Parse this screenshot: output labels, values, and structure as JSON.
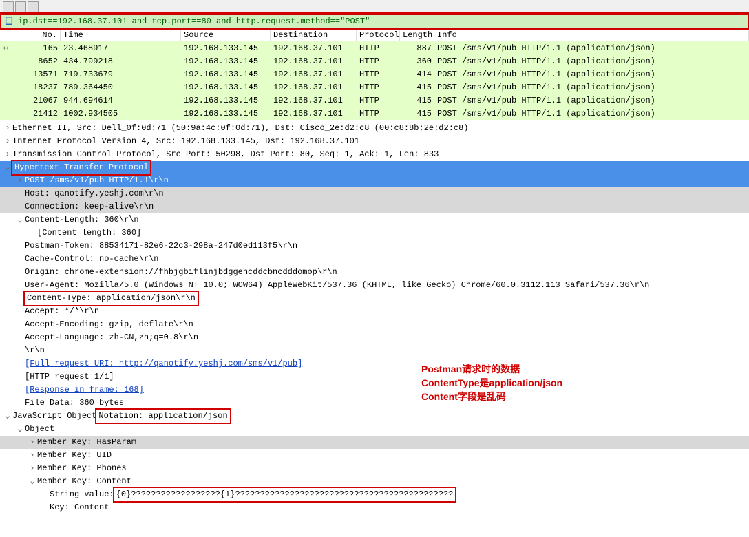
{
  "filter": {
    "value": "ip.dst==192.168.37.101 and tcp.port==80 and http.request.method==\"POST\""
  },
  "columns": {
    "no": "No.",
    "time": "Time",
    "src": "Source",
    "dst": "Destination",
    "proto": "Protocol",
    "len": "Length",
    "info": "Info"
  },
  "packets": [
    {
      "no": "165",
      "time": "23.468917",
      "src": "192.168.133.145",
      "dst": "192.168.37.101",
      "proto": "HTTP",
      "len": "887",
      "info": "POST /sms/v1/pub HTTP/1.1  (application/json)",
      "arrow": true
    },
    {
      "no": "8652",
      "time": "434.799218",
      "src": "192.168.133.145",
      "dst": "192.168.37.101",
      "proto": "HTTP",
      "len": "360",
      "info": "POST /sms/v1/pub HTTP/1.1  (application/json)"
    },
    {
      "no": "13571",
      "time": "719.733679",
      "src": "192.168.133.145",
      "dst": "192.168.37.101",
      "proto": "HTTP",
      "len": "414",
      "info": "POST /sms/v1/pub HTTP/1.1  (application/json)"
    },
    {
      "no": "18237",
      "time": "789.364450",
      "src": "192.168.133.145",
      "dst": "192.168.37.101",
      "proto": "HTTP",
      "len": "415",
      "info": "POST /sms/v1/pub HTTP/1.1  (application/json)"
    },
    {
      "no": "21067",
      "time": "944.694614",
      "src": "192.168.133.145",
      "dst": "192.168.37.101",
      "proto": "HTTP",
      "len": "415",
      "info": "POST /sms/v1/pub HTTP/1.1  (application/json)"
    },
    {
      "no": "21412",
      "time": "1002.934505",
      "src": "192.168.133.145",
      "dst": "192.168.37.101",
      "proto": "HTTP",
      "len": "415",
      "info": "POST /sms/v1/pub HTTP/1.1  (application/json)"
    }
  ],
  "tree": {
    "eth": "Ethernet II, Src: Dell_0f:0d:71 (50:9a:4c:0f:0d:71), Dst: Cisco_2e:d2:c8 (00:c8:8b:2e:d2:c8)",
    "ip": "Internet Protocol Version 4, Src: 192.168.133.145, Dst: 192.168.37.101",
    "tcp": "Transmission Control Protocol, Src Port: 50298, Dst Port: 80, Seq: 1, Ack: 1, Len: 833",
    "http": "Hypertext Transfer Protocol",
    "post": "POST /sms/v1/pub HTTP/1.1\\r\\n",
    "host": "Host: qanotify.yeshj.com\\r\\n",
    "conn": "Connection: keep-alive\\r\\n",
    "clenh": "Content-Length: 360\\r\\n",
    "clen": "[Content length: 360]",
    "ptok": "Postman-Token: 88534171-82e6-22c3-298a-247d0ed113f5\\r\\n",
    "cache": "Cache-Control: no-cache\\r\\n",
    "orig": "Origin: chrome-extension://fhbjgbiflinjbdggehcddcbncdddomop\\r\\n",
    "ua": "User-Agent: Mozilla/5.0 (Windows NT 10.0; WOW64) AppleWebKit/537.36 (KHTML, like Gecko) Chrome/60.0.3112.113 Safari/537.36\\r\\n",
    "ctype": "Content-Type: application/json\\r\\n",
    "acc": "Accept: */*\\r\\n",
    "aenc": "Accept-Encoding: gzip, deflate\\r\\n",
    "alang": "Accept-Language: zh-CN,zh;q=0.8\\r\\n",
    "crlf": "\\r\\n",
    "furi": "[Full request URI: http://qanotify.yeshj.com/sms/v1/pub]",
    "hreq": "[HTTP request 1/1]",
    "resp": "[Response in frame: 168]",
    "fdat": "File Data: 360 bytes",
    "json_pre": "JavaScript Object ",
    "json_box": "Notation: application/json",
    "obj": "Object",
    "m_has": "Member Key: HasParam",
    "m_uid": "Member Key: UID",
    "m_ph": "Member Key: Phones",
    "m_ct": "Member Key: Content",
    "sv_lbl": "String value: ",
    "sv_val": "{0}??????????????????{1}????????????????????????????????????????????",
    "key": "Key: Content"
  },
  "annotation": {
    "l1": "Postman请求时的数据",
    "l2": "ContentType是application/json",
    "l3": "Content字段是乱码"
  }
}
